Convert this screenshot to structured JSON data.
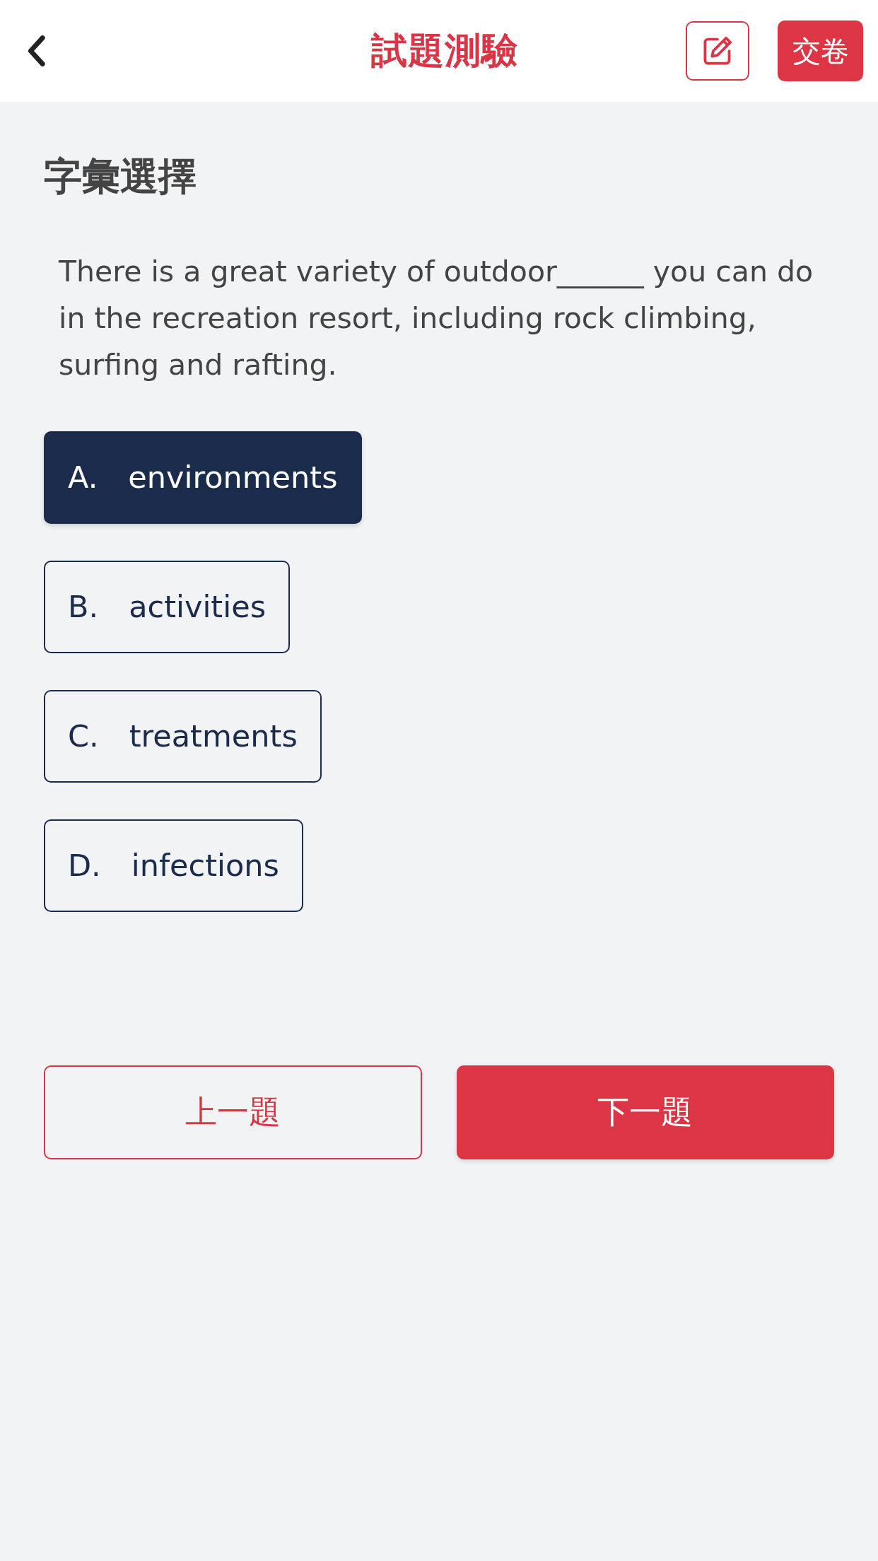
{
  "header": {
    "title": "試題測驗",
    "submit_button": "交卷"
  },
  "section_title": "字彙選擇",
  "question": {
    "text": "There is a great variety of outdoor______ you can do in the recreation resort, including rock climbing, surfing and rafting."
  },
  "options": [
    {
      "letter": "A.",
      "text": "environments",
      "selected": true
    },
    {
      "letter": "B.",
      "text": "activities",
      "selected": false
    },
    {
      "letter": "C.",
      "text": "treatments",
      "selected": false
    },
    {
      "letter": "D.",
      "text": "infections",
      "selected": false
    }
  ],
  "navigation": [
    {
      "label": "上一題",
      "kind": "outline"
    },
    {
      "label": "下一題",
      "kind": "filled"
    }
  ]
}
